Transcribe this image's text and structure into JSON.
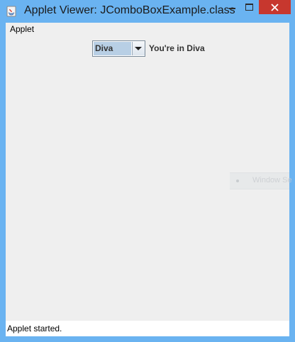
{
  "window": {
    "title": "Applet Viewer: JComboBoxExample.class",
    "app_icon": "java-cup-icon",
    "controls": {
      "minimize_icon": "minimize-icon",
      "maximize_icon": "maximize-icon",
      "close_icon": "close-icon"
    },
    "colors": {
      "titlebar": "#6ab3f1",
      "close_button": "#c7372e",
      "client_background": "#efefef"
    }
  },
  "menubar": {
    "items": [
      {
        "label": "Applet"
      }
    ]
  },
  "applet": {
    "combo": {
      "selected": "Diva",
      "arrow_icon": "chevron-down-icon",
      "colors": {
        "selection_highlight": "#b8cfe5"
      }
    },
    "label": "You're in Diva"
  },
  "overlay": {
    "text": "Window Se"
  },
  "statusbar": {
    "text": "Applet started."
  }
}
